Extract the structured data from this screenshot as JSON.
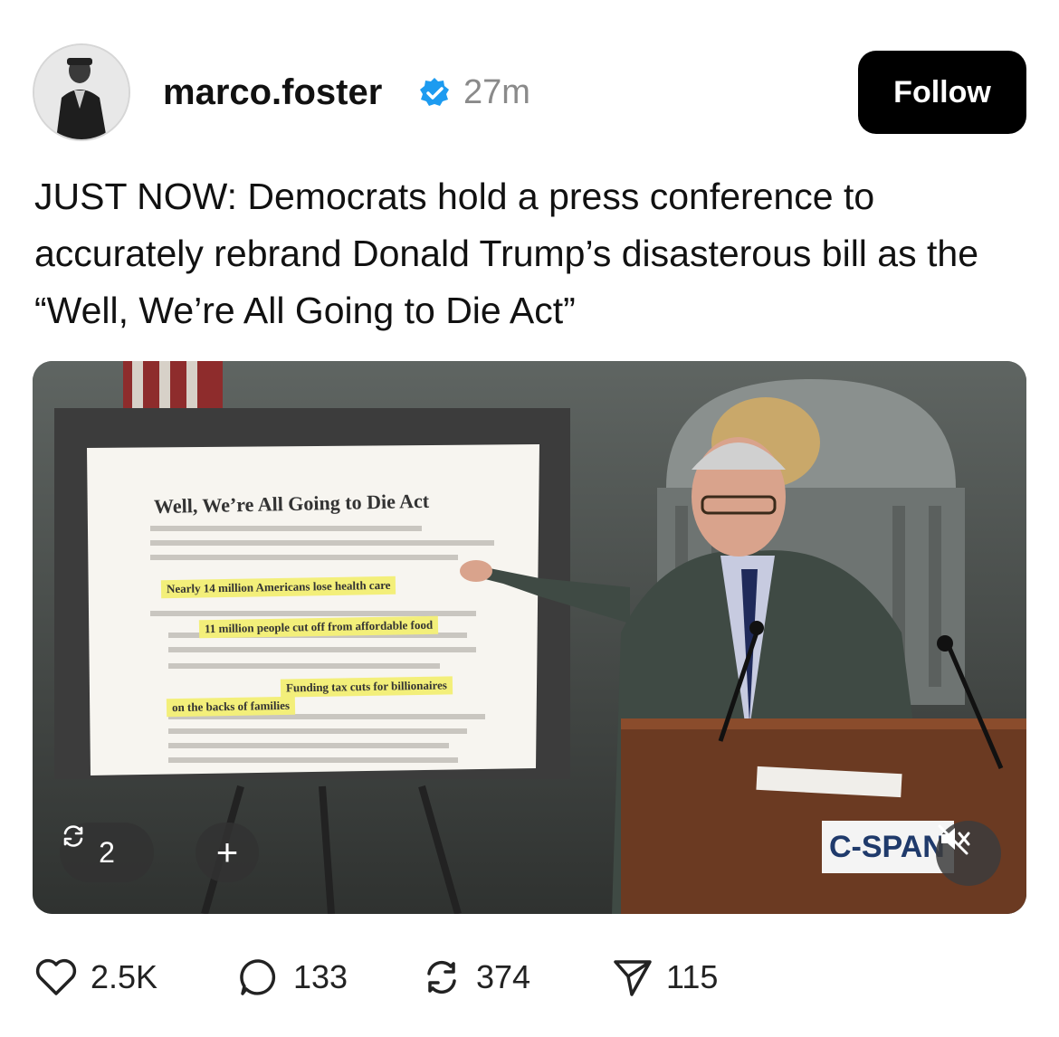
{
  "post": {
    "username": "marco.foster",
    "time": "27m",
    "follow_label": "Follow",
    "text": "JUST NOW: Democrats hold a press conference to accurately rebrand Donald Trump’s disasterous bill as the “Well, We’re All Going to Die Act”"
  },
  "media": {
    "doc_title": "Well, We’re All Going to Die Act",
    "highlights": [
      "Nearly 14 million Americans lose health care",
      "11 million people cut off from affordable food",
      "Funding tax cuts for billionaires",
      "on the backs of families"
    ],
    "repost_count": "2",
    "add_label": "+",
    "network_label": "C-SPAN"
  },
  "actions": {
    "likes": "2.5K",
    "comments": "133",
    "reposts": "374",
    "shares": "115"
  },
  "colors": {
    "verified": "#1d9bf0",
    "button_bg": "#000000",
    "highlight": "#f3ef7a"
  }
}
